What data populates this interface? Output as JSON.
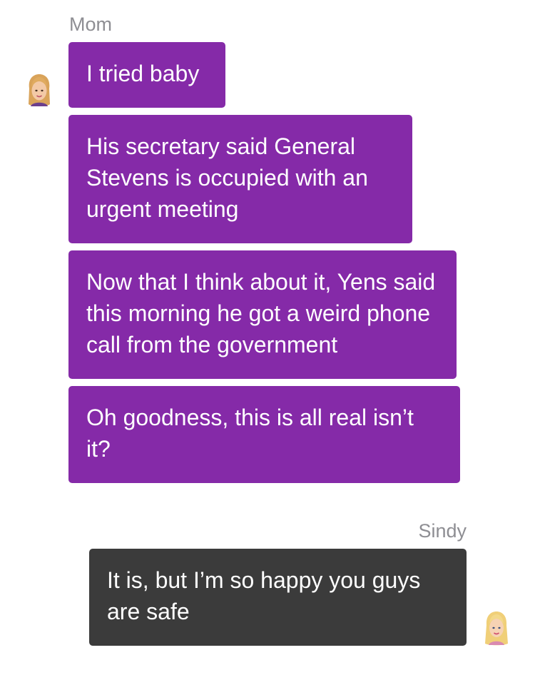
{
  "incoming": {
    "sender": "Mom",
    "messages": [
      "I tried baby",
      "His secretary said General Stevens is occupied with an urgent meeting",
      "Now that I think about it, Yens said this morning he got a weird phone call from the government",
      "Oh goodness, this is all real isn’t it?"
    ],
    "bubble_color": "#852aa8",
    "avatar_icon": "blonde-woman-avatar"
  },
  "outgoing": {
    "sender": "Sindy",
    "messages": [
      "It is, but I’m so happy you guys are safe"
    ],
    "bubble_color": "#3b3b3b",
    "avatar_icon": "blonde-girl-avatar"
  }
}
